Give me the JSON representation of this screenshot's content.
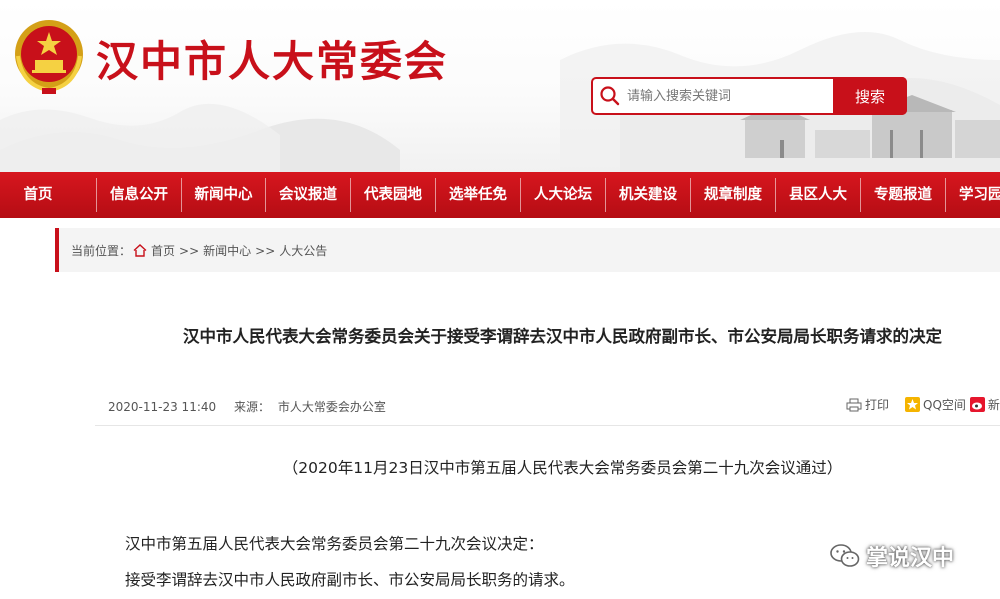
{
  "site": {
    "title": "汉中市人大常委会",
    "emblem_name": "national-emblem",
    "brand_color": "#c8101a"
  },
  "search": {
    "placeholder": "请输入搜索关键词",
    "button_label": "搜索"
  },
  "nav": {
    "items": [
      {
        "label": "首页"
      },
      {
        "label": "信息公开"
      },
      {
        "label": "新闻中心"
      },
      {
        "label": "会议报道"
      },
      {
        "label": "代表园地"
      },
      {
        "label": "选举任免"
      },
      {
        "label": "人大论坛"
      },
      {
        "label": "机关建设"
      },
      {
        "label": "规章制度"
      },
      {
        "label": "县区人大"
      },
      {
        "label": "专题报道"
      },
      {
        "label": "学习园地"
      }
    ]
  },
  "breadcrumb": {
    "prefix": "当前位置：",
    "home": "首页",
    "sep1": ">>",
    "level2": "新闻中心",
    "sep2": ">>",
    "level3": "人大公告"
  },
  "article": {
    "title": "汉中市人民代表大会常务委员会关于接受李谓辞去汉中市人民政府副市长、市公安局局长职务请求的决定",
    "date": "2020-11-23 11:40",
    "source_label": "来源：",
    "source": "市人大常委会办公室",
    "print_label": "打印",
    "qq_label": "QQ空间",
    "weibo_label": "新浪",
    "subtitle": "（2020年11月23日汉中市第五届人民代表大会常务委员会第二十九次会议通过）",
    "para1": "汉中市第五届人民代表大会常务委员会第二十九次会议决定：",
    "para2": "接受李谓辞去汉中市人民政府副市长、市公安局局长职务的请求。"
  },
  "watermark": {
    "text": "掌说汉中",
    "icon": "wechat-icon"
  }
}
